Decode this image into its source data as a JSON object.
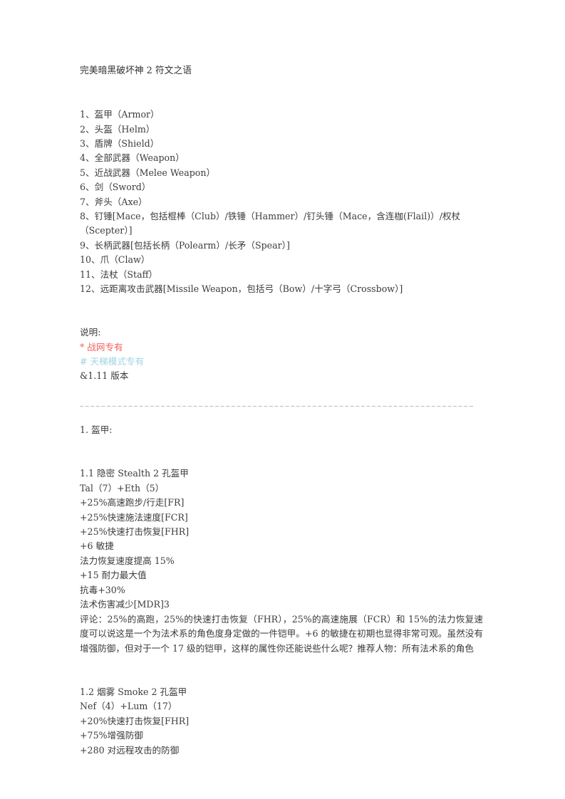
{
  "document": {
    "title": "完美暗黑破坏神 2 符文之语",
    "category_list": [
      "1、盔甲（Armor）",
      "2、头盔（Helm）",
      "3、盾牌（Shield）",
      "4、全部武器（Weapon）",
      "5、近战武器（Melee Weapon）",
      "6、剑（Sword）",
      "7、斧头（Axe）",
      "8、钉锤[Mace，包括棍棒（Club）/铁锤（Hammer）/钉头锤（Mace，含连枷(Flail)）/权杖（Scepter）]",
      "9、长柄武器[包括长柄（Polearm）/长矛（Spear）]",
      "10、爪（Claw）",
      "11、法杖（Staff）",
      "12、远距离攻击武器[Missile Weapon，包括弓（Bow）/十字弓（Crossbow）]"
    ],
    "legend": {
      "heading": "说明:",
      "entries": [
        {
          "text": "* 战网专有",
          "color": "#f1625e"
        },
        {
          "text": "# 天梯模式专有",
          "color": "#9fd4e3"
        },
        {
          "text": "&1.11 版本",
          "color": "#3b3b3b"
        }
      ]
    },
    "section_heading": "1. 盔甲:",
    "runewords": [
      {
        "heading": "1.1 隐密 Stealth 2 孔盔甲",
        "runes": "Tal（7）+Eth（5）",
        "stats": [
          "+25%高速跑步/行走[FR]",
          "+25%快速施法速度[FCR]",
          "+25%快速打击恢复[FHR]",
          "+6 敏捷",
          "法力恢复速度提高 15%",
          "+15 耐力最大值",
          "抗毒+30%",
          "法术伤害减少[MDR]3"
        ],
        "comment": "评论：25%的高跑，25%的快速打击恢复（FHR），25%的高速施展（FCR）和 15%的法力恢复速度可以说这是一个为法术系的角色度身定做的一件铠甲。+6 的敏捷在初期也显得非常可观。虽然没有增强防御，但对于一个 17 级的铠甲，这样的属性你还能说些什么呢？推荐人物：所有法术系的角色"
      },
      {
        "heading": "1.2 烟雾 Smoke 2 孔盔甲",
        "runes": "Nef（4）+Lum（17）",
        "stats": [
          "+20%快速打击恢复[FHR]",
          "+75%增强防御",
          "+280 对远程攻击的防御"
        ],
        "comment": ""
      }
    ]
  }
}
